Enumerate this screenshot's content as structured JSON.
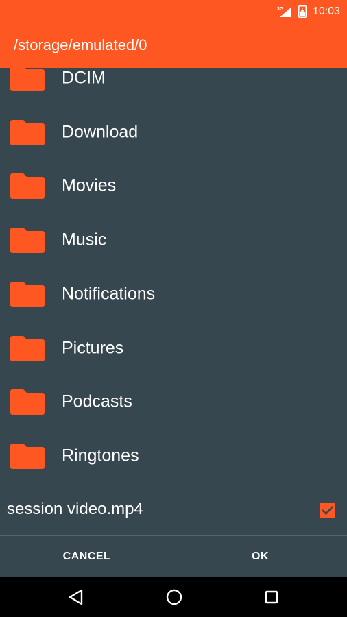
{
  "status_bar": {
    "network": "3G",
    "time": "10:03",
    "icons": [
      "signal-icon",
      "battery-icon"
    ]
  },
  "toolbar": {
    "path": "/storage/emulated/0"
  },
  "folders": [
    {
      "label": "DCIM",
      "icon": "folder-icon"
    },
    {
      "label": "Download",
      "icon": "folder-icon"
    },
    {
      "label": "Movies",
      "icon": "folder-icon"
    },
    {
      "label": "Music",
      "icon": "folder-icon"
    },
    {
      "label": "Notifications",
      "icon": "folder-icon"
    },
    {
      "label": "Pictures",
      "icon": "folder-icon"
    },
    {
      "label": "Podcasts",
      "icon": "folder-icon"
    },
    {
      "label": "Ringtones",
      "icon": "folder-icon"
    }
  ],
  "file": {
    "name": "session video.mp4",
    "checked": true
  },
  "buttons": {
    "cancel": "CANCEL",
    "ok": "OK"
  },
  "nav": {
    "icons": [
      "back-icon",
      "home-icon",
      "recents-icon"
    ]
  },
  "colors": {
    "accent": "#FF5722",
    "background": "#37474F",
    "text": "#FFFFFF",
    "nav_bar": "#000000"
  }
}
